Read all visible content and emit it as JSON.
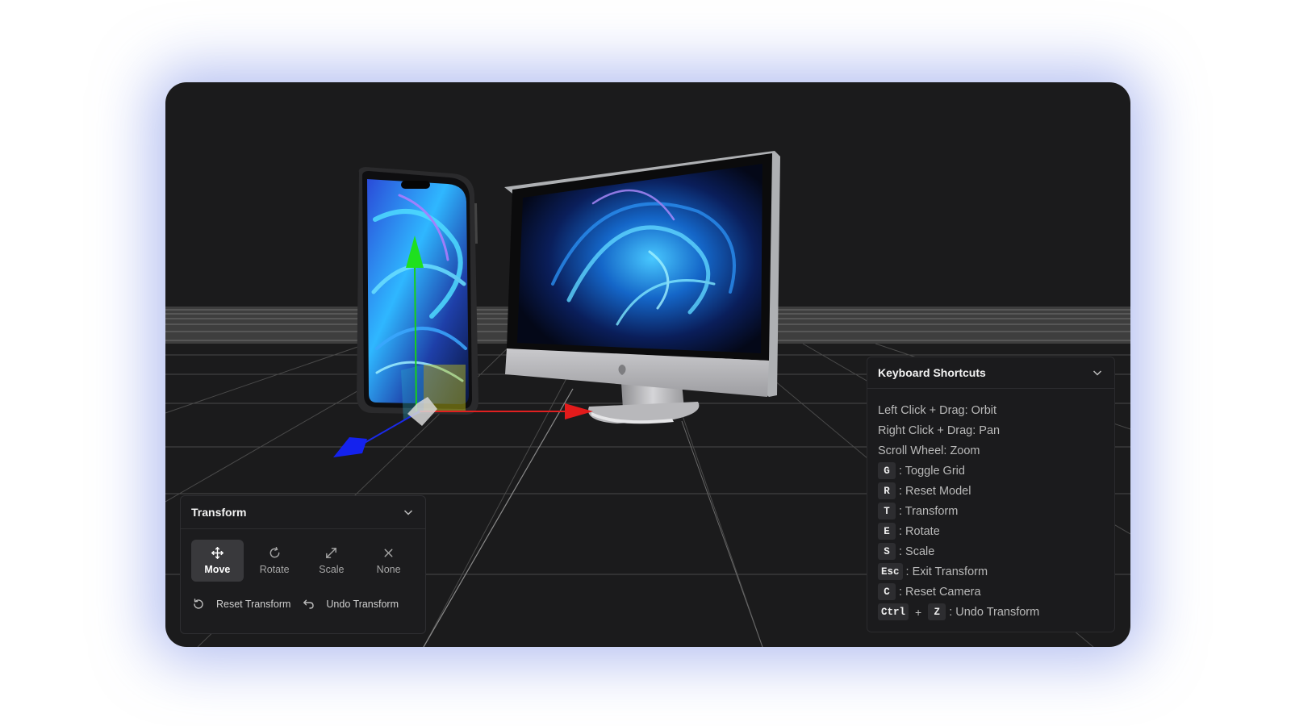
{
  "transform_panel": {
    "title": "Transform",
    "modes": [
      {
        "label": "Move",
        "icon": "move-icon",
        "active": true
      },
      {
        "label": "Rotate",
        "icon": "rotate-icon",
        "active": false
      },
      {
        "label": "Scale",
        "icon": "scale-icon",
        "active": false
      },
      {
        "label": "None",
        "icon": "close-icon",
        "active": false
      }
    ],
    "reset_label": "Reset Transform",
    "undo_label": "Undo Transform"
  },
  "shortcuts_panel": {
    "title": "Keyboard Shortcuts",
    "mouse": [
      "Left Click + Drag: Orbit",
      "Right Click + Drag: Pan",
      "Scroll Wheel: Zoom"
    ],
    "keys": [
      {
        "key": "G",
        "text": ": Toggle Grid"
      },
      {
        "key": "R",
        "text": ": Reset Model"
      },
      {
        "key": "T",
        "text": ": Transform"
      },
      {
        "key": "E",
        "text": ": Rotate"
      },
      {
        "key": "S",
        "text": ": Scale"
      },
      {
        "key": "Esc",
        "text": ": Exit Transform"
      },
      {
        "key": "C",
        "text": ": Reset Camera"
      }
    ],
    "combo": {
      "key1": "Ctrl",
      "plus": "+",
      "key2": "Z",
      "text": ": Undo Transform"
    }
  },
  "colors": {
    "viewport_bg": "#1b1b1c",
    "panel_bg": "#1c1c1e",
    "gizmo_x": "#e02020",
    "gizmo_y": "#18d018",
    "gizmo_z": "#1a2ae8",
    "glow": "#7f93e6"
  },
  "scene": {
    "objects": [
      "smartphone-model",
      "desktop-monitor-model"
    ],
    "gizmo_icons": [
      "move-gizmo"
    ]
  }
}
